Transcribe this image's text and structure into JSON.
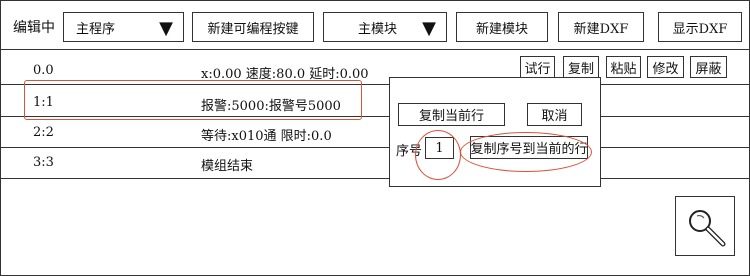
{
  "header": {
    "edit_label": "编辑中",
    "program_select": "主程序",
    "new_prog_button": "新建可编程按键",
    "module_select": "主模块",
    "new_module_button": "新建模块",
    "new_dxf_button": "新建DXF",
    "show_dxf_button": "显示DXF"
  },
  "toolbar": {
    "test_run": "试行",
    "copy": "复制",
    "paste": "粘贴",
    "modify": "修改",
    "shield": "屏蔽"
  },
  "rows": [
    {
      "index": "0.0",
      "text": "x:0.00 速度:80.0 延时:0.00"
    },
    {
      "index": "1:1",
      "text": "报警:5000:报警号5000"
    },
    {
      "index": "2:2",
      "text": "等待:x010通 限时:0.0"
    },
    {
      "index": "3:3",
      "text": "模组结束"
    }
  ],
  "dialog": {
    "copy_current": "复制当前行",
    "cancel": "取消",
    "seq_label": "序号",
    "seq_value": "1",
    "copy_to_current": "复制序号到当前的行"
  },
  "icons": {
    "search": "search-icon",
    "dropdown": "triangle-down-icon"
  }
}
